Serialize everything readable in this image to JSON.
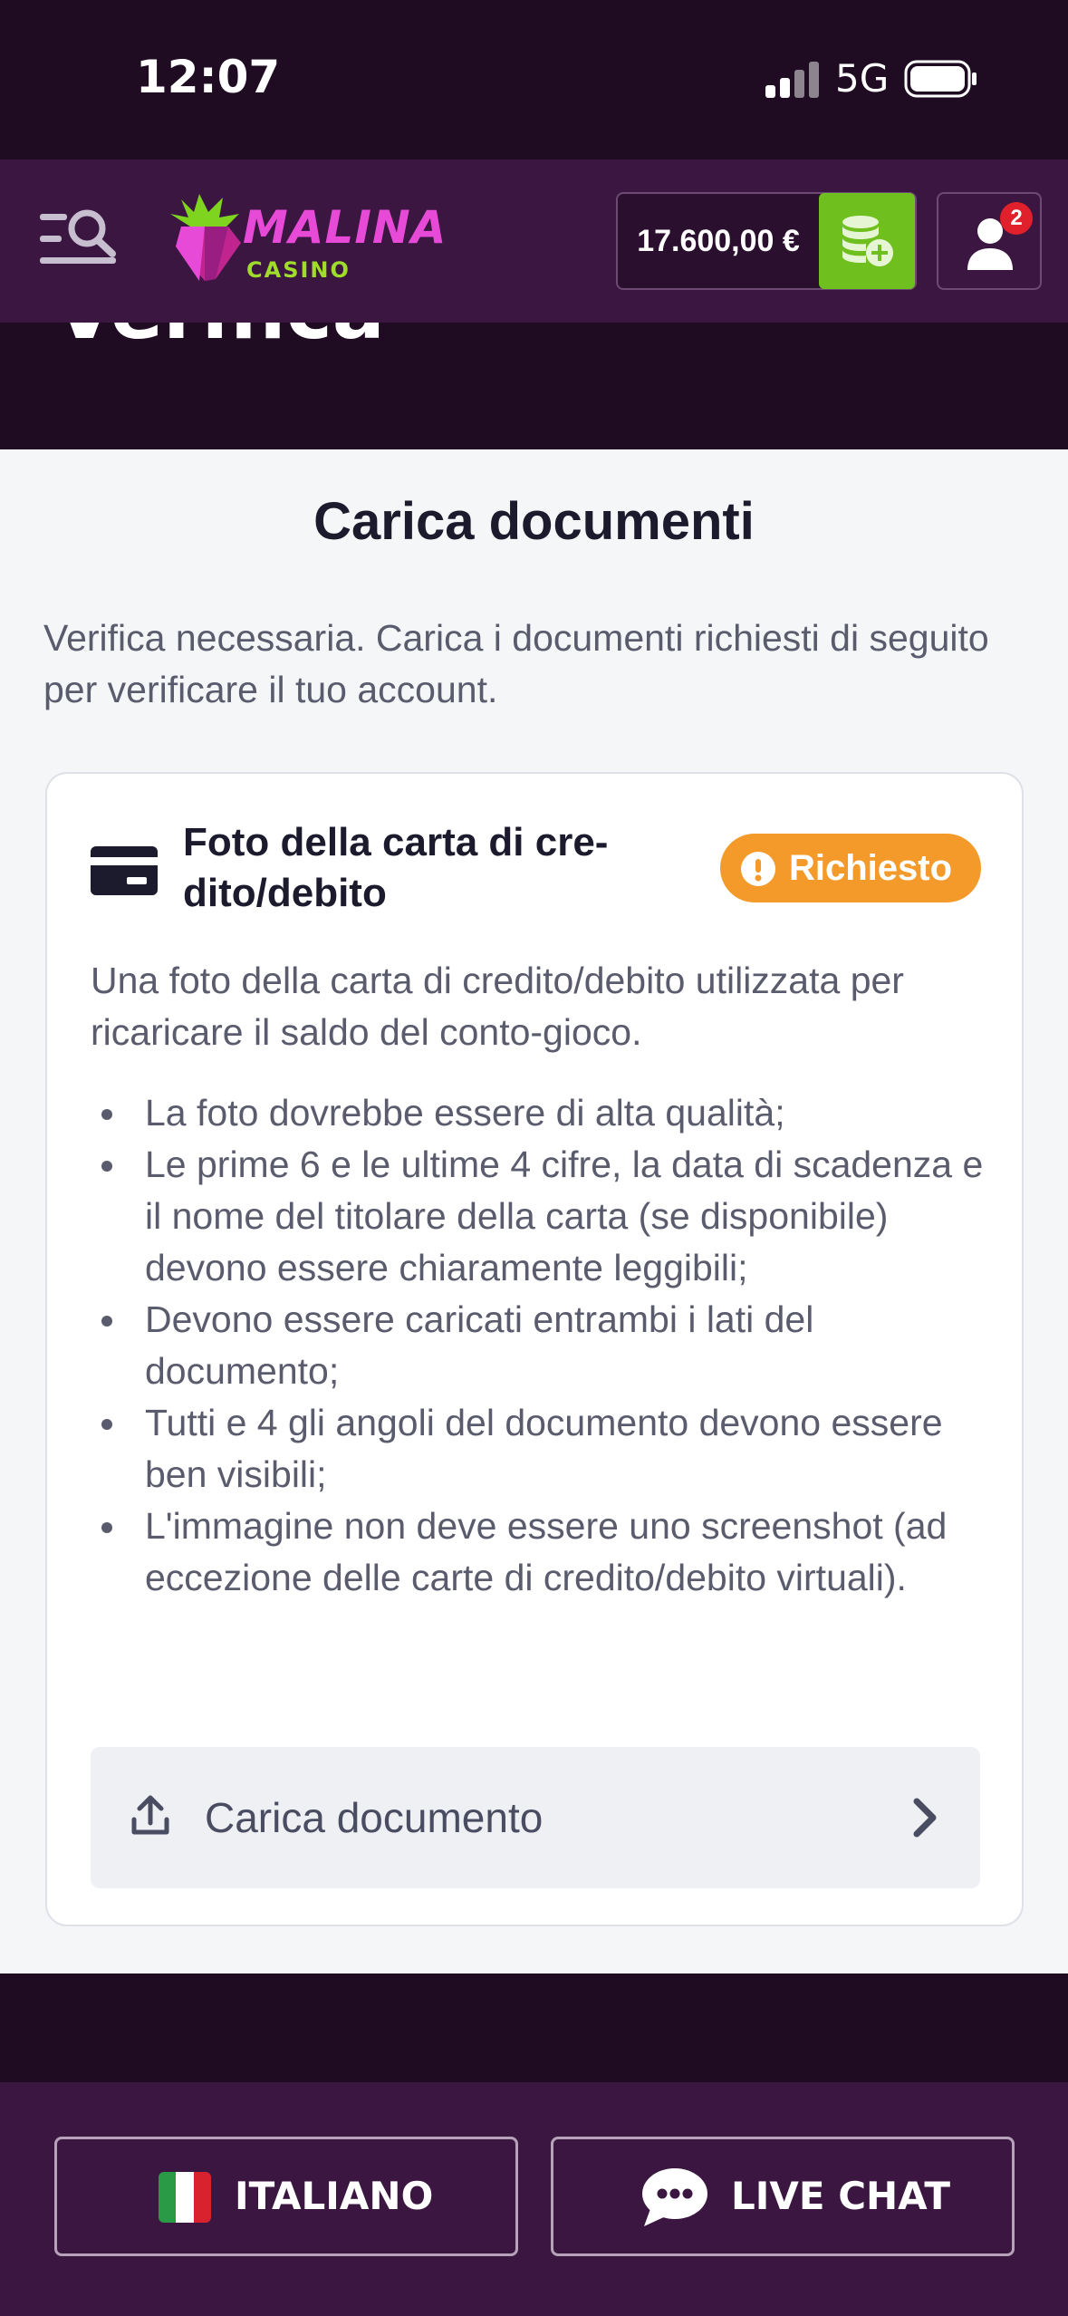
{
  "status_bar": {
    "time": "12:07",
    "network": "5G"
  },
  "header": {
    "logo_text": "MALINA",
    "logo_sub": "CASINO",
    "balance": "17.600,00 €",
    "notifications_count": "2"
  },
  "hero": {
    "title": "Verifica"
  },
  "main": {
    "title": "Carica documenti",
    "description": "Verifica necessaria. Carica i documenti richiesti di seguito per verificare il tuo account."
  },
  "card": {
    "title": "Foto della carta di cre-dito/debito",
    "status": "Richiesto",
    "description": "Una foto della carta di credito/debito utilizzata per ricaricare il saldo del conto-gioco.",
    "requirements": [
      "La foto dovrebbe essere di alta qualità;",
      "Le prime 6 e le ultime 4 cifre, la data di scadenza e il nome del titolare della carta (se disponibile) devono essere chiaramente leggibili;",
      "Devono essere caricati entrambi i lati del documento;",
      "Tutti e 4 gli angoli del documento devono essere ben visibili;",
      "L'immagine non deve essere uno screenshot (ad eccezione delle carte di credito/debito virtuali)."
    ],
    "upload_label": "Carica documento"
  },
  "footer": {
    "language_label": "ITALIANO",
    "chat_label": "LIVE CHAT"
  },
  "colors": {
    "page_dark": "#1f0b22",
    "header_purple": "#3a1640",
    "deposit_green": "#6fc01e",
    "status_orange": "#f39a2b",
    "logo_pink": "#e84ad8"
  }
}
